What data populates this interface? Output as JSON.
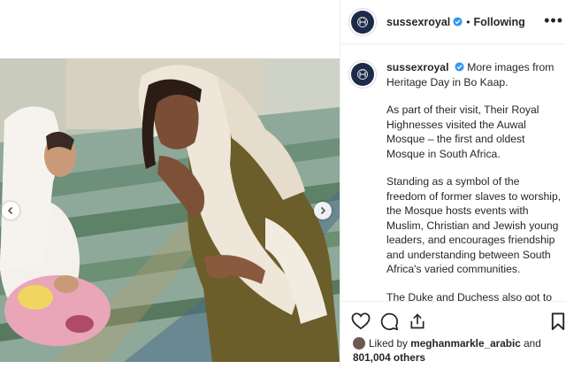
{
  "post": {
    "username": "sussexroyal",
    "follow_state": "Following",
    "separator": "•",
    "more": "•••"
  },
  "caption": {
    "username": "sussexroyal",
    "intro": "More images from Heritage Day in Bo Kaap.",
    "paragraphs": [
      "As part of their visit, Their Royal Highnesses visited the Auwal Mosque – the first and oldest Mosque in South Africa.",
      "Standing as a symbol of the freedom of former slaves to worship, the Mosque hosts events with Muslim, Christian and Jewish young leaders, and encourages friendship and understanding between South Africa's varied communities.",
      "The Duke and Duchess also got to view the first known manuscript of the Qu'ran in Africa, drafted by Tuan Guru"
    ]
  },
  "likes": {
    "prefix": "Liked by",
    "liker": "meghanmarkle_arabic",
    "conjunction": "and",
    "others": "801,004 others"
  },
  "icons": {
    "verified": "verified-badge-icon",
    "like": "heart-icon",
    "comment": "comment-icon",
    "share": "share-icon",
    "save": "bookmark-icon",
    "prev": "chevron-left-icon",
    "next": "chevron-right-icon"
  },
  "colors": {
    "verified_blue": "#3897f0",
    "avatar_navy": "#1d2a4a",
    "divider": "#efefef"
  }
}
